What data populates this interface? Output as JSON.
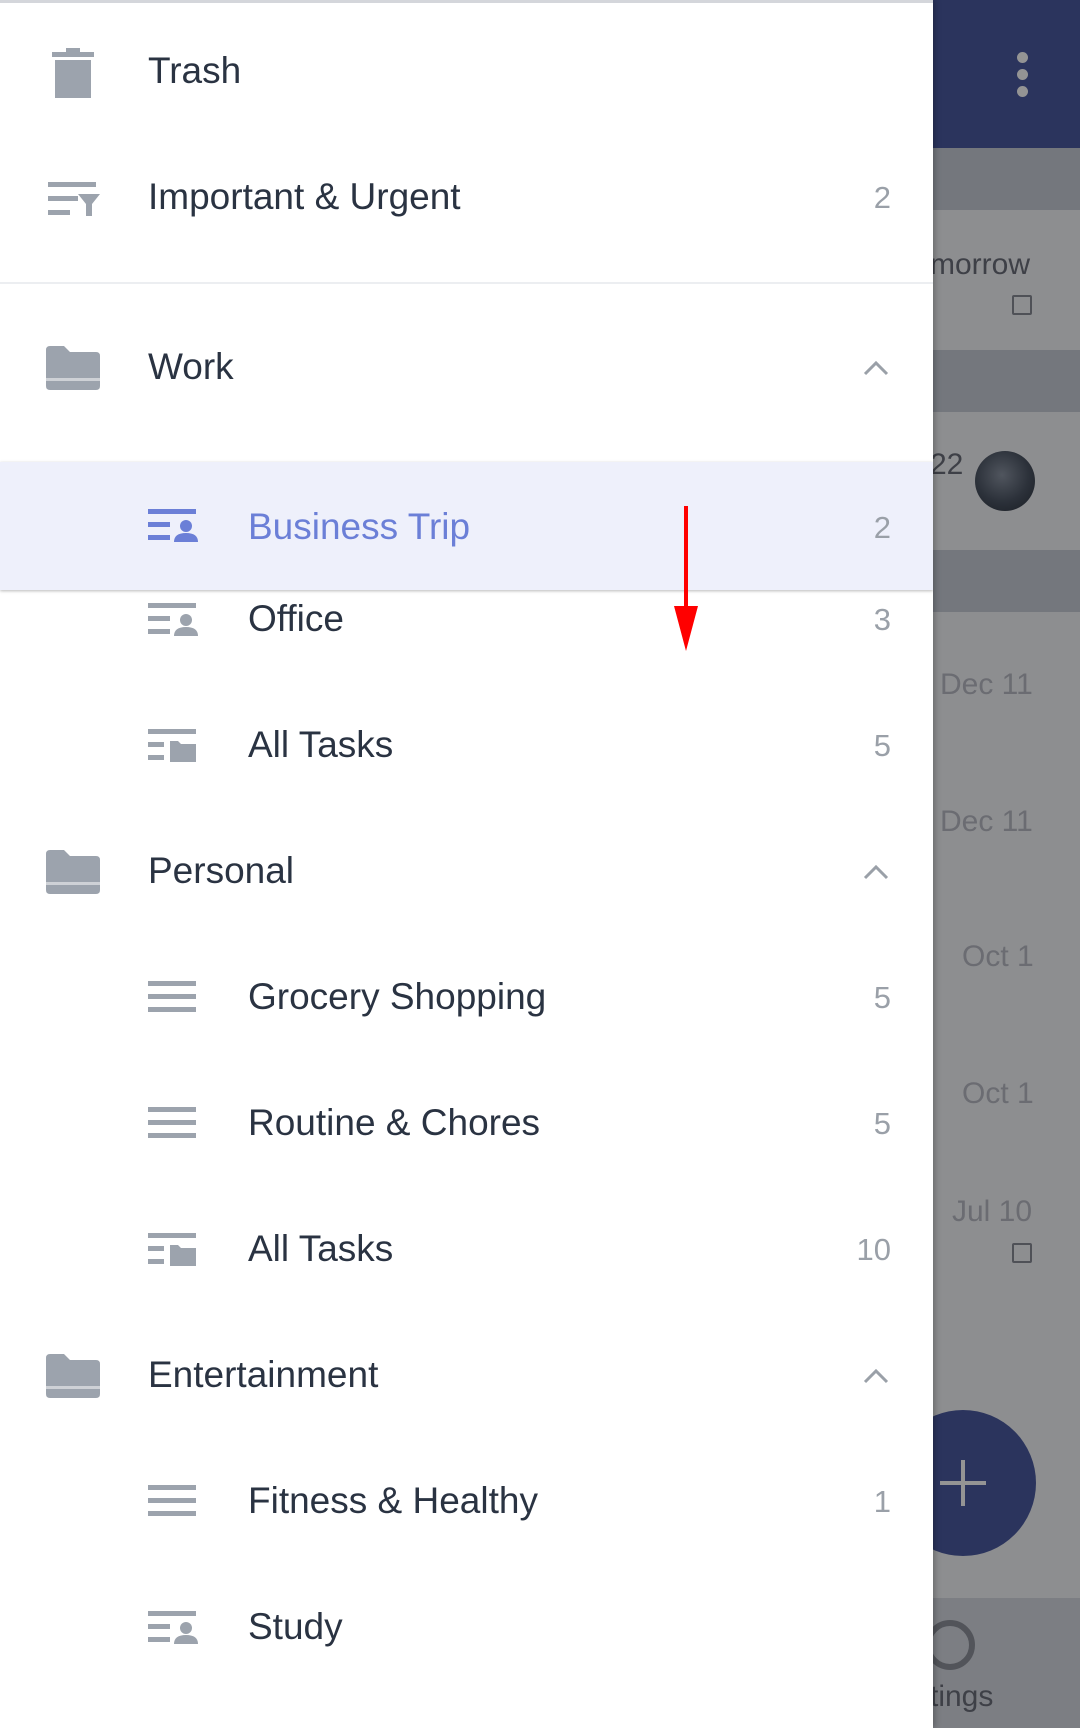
{
  "background": {
    "items": [
      {
        "text": "morrow"
      },
      {
        "text": "22"
      },
      {
        "text": "Dec 11"
      },
      {
        "text": "Dec 11"
      },
      {
        "text": "Oct 1"
      },
      {
        "text": "Oct 1"
      },
      {
        "text": "Jul 10"
      }
    ],
    "settings_label": "tings",
    "fab_icon": "plus-icon",
    "menu_icon": "more-vert-icon",
    "colors": {
      "header": "#4a5aa0",
      "accent": "#6b7fd7"
    }
  },
  "drawer": {
    "trash": {
      "label": "Trash",
      "icon": "trash-icon"
    },
    "important": {
      "label": "Important & Urgent",
      "count": "2",
      "icon": "filter-list-icon"
    },
    "groups": [
      {
        "label": "Work",
        "icon": "folder-icon",
        "expanded": true,
        "lists": [
          {
            "label": "Business Trip",
            "count": "2",
            "icon": "shared-list-icon",
            "selected": true
          },
          {
            "label": "Office",
            "count": "3",
            "icon": "shared-list-icon"
          },
          {
            "label": "All Tasks",
            "count": "5",
            "icon": "all-tasks-icon"
          }
        ]
      },
      {
        "label": "Personal",
        "icon": "folder-icon",
        "expanded": true,
        "lists": [
          {
            "label": "Grocery Shopping",
            "count": "5",
            "icon": "list-icon"
          },
          {
            "label": "Routine & Chores",
            "count": "5",
            "icon": "list-icon"
          },
          {
            "label": "All Tasks",
            "count": "10",
            "icon": "all-tasks-icon"
          }
        ]
      },
      {
        "label": "Entertainment",
        "icon": "folder-icon",
        "expanded": true,
        "lists": [
          {
            "label": "Fitness & Healthy",
            "count": "1",
            "icon": "list-icon"
          },
          {
            "label": "Study",
            "count": "",
            "icon": "shared-list-icon"
          }
        ]
      }
    ]
  },
  "annotation": {
    "gesture": "drag-down-arrow",
    "color": "#ff0000"
  }
}
